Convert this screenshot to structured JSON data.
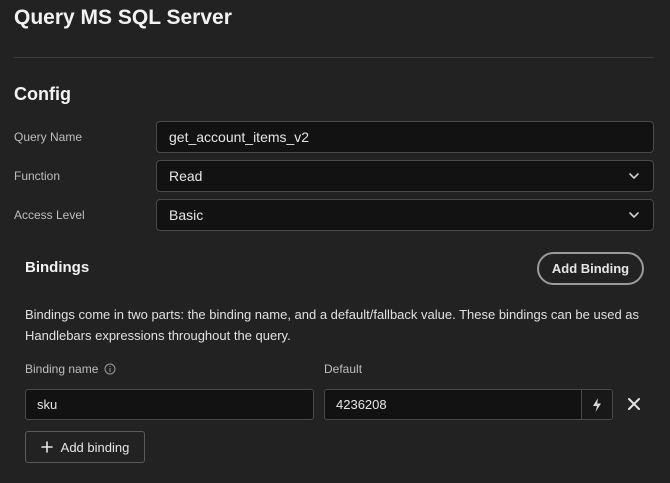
{
  "page": {
    "title": "Query MS SQL Server"
  },
  "config": {
    "title": "Config",
    "query_name": {
      "label": "Query Name",
      "value": "get_account_items_v2"
    },
    "function": {
      "label": "Function",
      "value": "Read"
    },
    "access_level": {
      "label": "Access Level",
      "value": "Basic"
    }
  },
  "bindings": {
    "title": "Bindings",
    "add_button_label": "Add Binding",
    "description": "Bindings come in two parts: the binding name, and a default/fallback value. These bindings can be used as Handlebars expressions throughout the query.",
    "name_column_label": "Binding name",
    "default_column_label": "Default",
    "rows": [
      {
        "name": "sku",
        "default": "4236208"
      }
    ],
    "add_row_label": "Add binding"
  },
  "icons": {
    "select_caret": "chevron-down-icon",
    "info": "info-icon",
    "bolt": "bolt-icon",
    "remove": "close-icon",
    "add": "plus-icon"
  }
}
